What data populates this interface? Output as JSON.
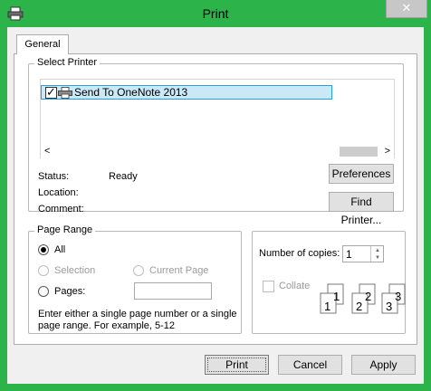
{
  "window": {
    "title": "Print",
    "close_glyph": "✕"
  },
  "tabs": [
    {
      "label": "General"
    }
  ],
  "select_printer": {
    "group_label": "Select Printer",
    "printers": [
      {
        "name": "Send To OneNote 2013",
        "checked": true,
        "icon": "printer-icon"
      }
    ],
    "scroll_left": "<",
    "scroll_right": ">"
  },
  "status": {
    "status_label": "Status:",
    "status_value": "Ready",
    "location_label": "Location:",
    "location_value": "",
    "comment_label": "Comment:",
    "comment_value": ""
  },
  "buttons": {
    "preferences": "Preferences",
    "find_printer": "Find Printer...",
    "print": "Print",
    "cancel": "Cancel",
    "apply": "Apply"
  },
  "page_range": {
    "group_label": "Page Range",
    "all": "All",
    "selection": "Selection",
    "current_page": "Current Page",
    "pages": "Pages:",
    "pages_value": "",
    "selected": "all",
    "note": "Enter either a single page number or a single page range.  For example, 5-12"
  },
  "copies": {
    "label": "Number of copies:",
    "value": "1",
    "collate": "Collate",
    "collate_checked": false,
    "collate_pages": [
      "1",
      "1",
      "2",
      "2",
      "3",
      "3"
    ]
  },
  "colors": {
    "titlebar": "#2cb34a",
    "selection": "#cbe8f6",
    "selection_border": "#26a0da"
  }
}
